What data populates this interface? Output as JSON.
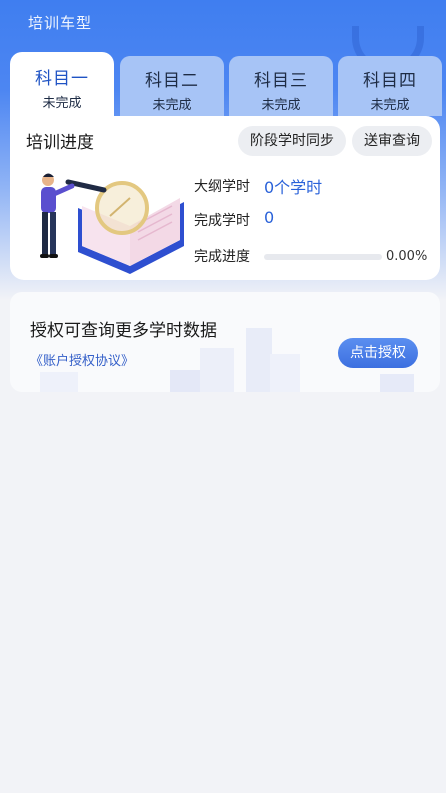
{
  "header": {
    "title": "培训车型"
  },
  "tabs": [
    {
      "name": "科目一",
      "status": "未完成",
      "active": true
    },
    {
      "name": "科目二",
      "status": "未完成",
      "active": false
    },
    {
      "name": "科目三",
      "status": "未完成",
      "active": false
    },
    {
      "name": "科目四",
      "status": "未完成",
      "active": false
    }
  ],
  "progress": {
    "title": "培训进度",
    "sync_button": "阶段学时同步",
    "review_button": "送审查询",
    "syllabus_hours_label": "大纲学时",
    "syllabus_hours_value": "0个学时",
    "completed_hours_label": "完成学时",
    "completed_hours_value": "0",
    "completion_label": "完成进度",
    "completion_value": "0.00%",
    "completion_fraction": 0
  },
  "auth": {
    "title": "授权可查询更多学时数据",
    "agreement_link": "《账户授权协议》",
    "authorize_button": "点击授权"
  },
  "colors": {
    "primary": "#3f7ef0",
    "accent_text": "#2a62d9",
    "page_bg": "#f2f3f7"
  }
}
